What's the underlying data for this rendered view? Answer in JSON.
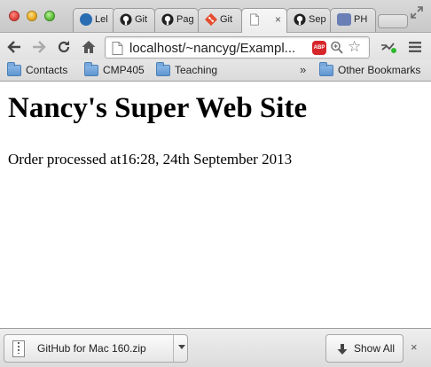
{
  "tabs": [
    {
      "label": "Lel",
      "icon": "lel-favicon-icon",
      "color": "#2a6db3"
    },
    {
      "label": "Git",
      "icon": "github-icon",
      "color": "#333333"
    },
    {
      "label": "Pag",
      "icon": "github-icon",
      "color": "#333333"
    },
    {
      "label": "Git",
      "icon": "git-icon",
      "color": "#e44c30"
    },
    {
      "label": "",
      "icon": "blank-page-icon",
      "active": true
    },
    {
      "label": "Sep",
      "icon": "github-icon",
      "color": "#333333"
    },
    {
      "label": "PH",
      "icon": "php-icon",
      "color": "#6a7fb5"
    }
  ],
  "tab_close_glyph": "×",
  "toolbar": {
    "back_icon": "arrow-left-icon",
    "forward_icon": "arrow-right-icon",
    "reload_icon": "reload-icon",
    "home_icon": "home-icon",
    "url": "localhost/~nancyg/Exampl...",
    "adblock_label": "ABP",
    "menu_icon": "hamburger-menu-icon"
  },
  "bookmarks": {
    "items": [
      {
        "label": "Contacts"
      },
      {
        "label": "CMP405"
      },
      {
        "label": "Teaching"
      }
    ],
    "overflow": "»",
    "other": "Other Bookmarks"
  },
  "page": {
    "title": "Nancy's Super Web Site",
    "message": "Order processed at16:28, 24th September 2013"
  },
  "downloads": {
    "file_name": "GitHub for Mac 160.zip",
    "show_all": "Show All",
    "close_glyph": "×"
  }
}
